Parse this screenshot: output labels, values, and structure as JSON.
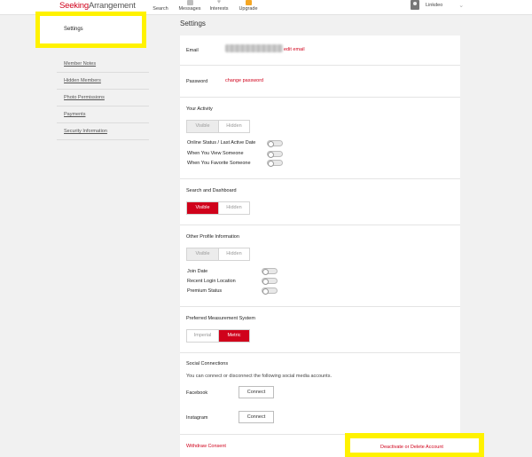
{
  "topbar": {
    "logo_part1": "Seeking",
    "logo_part2": "Arrangement",
    "nav": [
      {
        "label": "Search",
        "icon": "search-icon"
      },
      {
        "label": "Messages",
        "icon": "messages-icon"
      },
      {
        "label": "Interests",
        "icon": "heart-icon"
      },
      {
        "label": "Upgrade",
        "icon": "upgrade-icon"
      }
    ],
    "username": "Linkdeo"
  },
  "sidebar": {
    "active": "Settings",
    "items": [
      "Member Notes",
      "Hidden Members",
      "Photo Permissions",
      "Payments",
      "Security Information"
    ]
  },
  "main": {
    "title": "Settings",
    "email_label": "Email",
    "email_link": "edit email",
    "password_label": "Password",
    "password_link": "change password",
    "activity": {
      "title": "Your Activity",
      "visible": "Visible",
      "hidden": "Hidden",
      "toggles": [
        "Online Status / Last Active Date",
        "When You View Someone",
        "When You Favorite Someone"
      ]
    },
    "search_dashboard": {
      "title": "Search and Dashboard",
      "visible": "Visible",
      "hidden": "Hidden"
    },
    "other_profile": {
      "title": "Other Profile Information",
      "visible": "Visible",
      "hidden": "Hidden",
      "toggles": [
        "Join Date",
        "Recent Login Location",
        "Premium Status"
      ]
    },
    "measurement": {
      "title": "Preferred Measurement System",
      "imperial": "Imperial",
      "metric": "Metric"
    },
    "social": {
      "title": "Social Connections",
      "desc": "You can connect or disconnect the following social media accounts.",
      "facebook": "Facebook",
      "instagram": "Instagram",
      "connect": "Connect"
    },
    "withdraw": "Withdraw Consent",
    "delete": "Deactivate or Delete Account"
  },
  "colors": {
    "accent": "#d0021b",
    "highlight": "#fff200"
  }
}
